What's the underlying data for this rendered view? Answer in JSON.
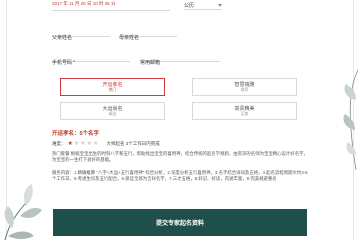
{
  "birth": {
    "date_text": "2017 年 11 月 20 日 10 时 35 分",
    "calendar_value": "公历"
  },
  "fields": {
    "father_label": "父亲姓名",
    "mother_label": "母亲姓名",
    "phone_label": "手机号码",
    "phone_required": "*",
    "email_label": "常用邮箱"
  },
  "options": [
    {
      "title": "开运孝名",
      "sub": "热门"
    },
    {
      "title": "智慧瑞雅",
      "sub": "推荐"
    },
    {
      "title": "大运尚名",
      "sub": "精选"
    },
    {
      "title": "高贵精美",
      "sub": "至尊"
    }
  ],
  "section": {
    "title": "开运孝名：5个名字",
    "rating_label": "难度：",
    "rating_value": 1,
    "rating_max": 5,
    "rating_text": "大师起名 3个工作日内完成"
  },
  "description": {
    "p1": "热门套餐 根据宝宝出生的时刻八字和五行，帮助找出宝宝的喜用神，结合传统的起名学规则，由资深的名师为宝宝精心设计好名字，为宝宝的一生打下良好的基础。",
    "p2": "服务内容：1.精确推算 \"八字+大运+五行喜用神\" 综合分析，2.深度分析五行喜用神，3.名字结合诗词及五格，4.起名流程周期大约3-5个工作日，5.考虑生肖及五行配合，6.保证全部为吉祥名字，7.三才五格，8.好记、好读，内涵丰富，9.完美规避重名"
  },
  "submit_label": "提交专家起名资料",
  "colors": {
    "accent": "#c0392b",
    "button": "#1f4f4a"
  }
}
